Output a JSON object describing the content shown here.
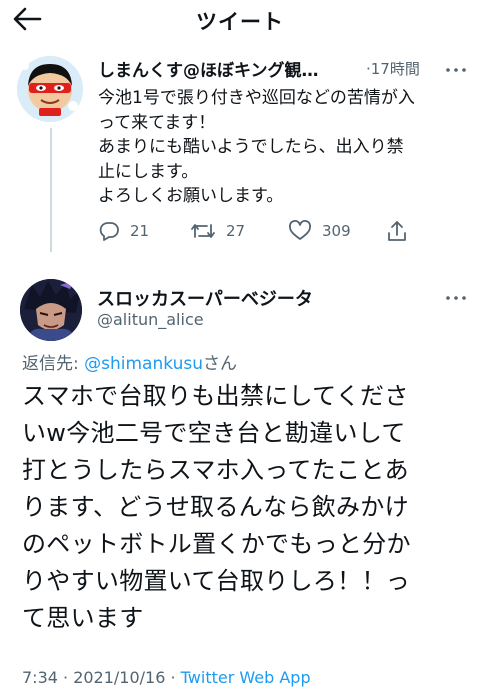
{
  "header": {
    "title": "ツイート"
  },
  "parent": {
    "name": "しまんくす@ほぼキング観…",
    "time": "·17時間",
    "text": "今池1号で張り付きや巡回などの苦情が入\nって来てます！\nあまりにも酷いようでしたら、出入り禁\n止にします。\nよろしくお願いします。",
    "replies": "21",
    "retweets": "27",
    "likes": "309"
  },
  "reply": {
    "name": "スロッカスーパーベジータ",
    "handle": "@alitun_alice",
    "replying_label": "返信先: ",
    "replying_mention": "@shimankusu",
    "replying_suffix": "さん",
    "text": "スマホで台取りも出禁にしてくださ\nいw今池二号で空き台と勘違いして\n打とうしたらスマホ入ってたことあ\nります、どうせ取るんなら飲みかけ\nのペットボトル置くかでもっと分か\nりやすい物置いて台取りしろ！！っ\nて思います",
    "timestamp": "7:34 · 2021/10/16 · ",
    "source": "Twitter Web App"
  },
  "colors": {
    "accent": "#1d9bf0",
    "muted": "#536471",
    "avatar_bg": "#d9ecf7",
    "mask": "#e0201c"
  }
}
